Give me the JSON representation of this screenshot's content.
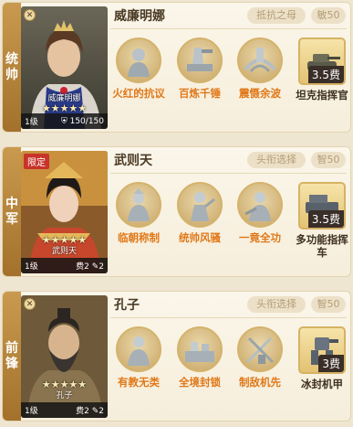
{
  "cards": [
    {
      "position_chars": [
        "统",
        "帅"
      ],
      "name": "威廉明娜",
      "portrait_name": "威廉明娜",
      "tag": "抵抗之母",
      "stat": "敏50",
      "stars": "★★★★★",
      "level": "1级",
      "troops": "150/150",
      "limited": false,
      "skills": [
        {
          "label": "火红的抗议",
          "icon": "protest-bust-icon",
          "orange": true
        },
        {
          "label": "百炼千锤",
          "icon": "forge-icon",
          "orange": true
        },
        {
          "label": "震慑余波",
          "icon": "shockwave-icon",
          "orange": true
        }
      ],
      "tactic": {
        "label": "坦克指挥官",
        "cost": "3.5费",
        "icon": "tank-icon"
      }
    },
    {
      "position_chars": [
        "中",
        "军"
      ],
      "name": "武则天",
      "portrait_name": "武则天",
      "tag": "头衔选择",
      "stat": "智50",
      "stars": "★★★★★",
      "level": "1级",
      "cost_text": "费2",
      "quill_text": "2",
      "limited": true,
      "limited_label": "限定",
      "skills": [
        {
          "label": "临朝称制",
          "icon": "empress-icon",
          "orange": true
        },
        {
          "label": "统帅风骚",
          "icon": "commander-icon",
          "orange": true
        },
        {
          "label": "一竟全功",
          "icon": "warrior-icon",
          "orange": true
        }
      ],
      "tactic": {
        "label": "多功能指挥车",
        "cost": "3.5费",
        "icon": "command-vehicle-icon"
      }
    },
    {
      "position_chars": [
        "前",
        "锋"
      ],
      "name": "孔子",
      "portrait_name": "孔子",
      "tag": "头衔选择",
      "stat": "智50",
      "stars": "★★★★★",
      "level": "1级",
      "cost_text": "费2",
      "quill_text": "2",
      "limited": false,
      "skills": [
        {
          "label": "有教无类",
          "icon": "sage-icon",
          "orange": true
        },
        {
          "label": "全境封锁",
          "icon": "lockdown-icon",
          "orange": true
        },
        {
          "label": "制敌机先",
          "icon": "swords-icon",
          "orange": true
        }
      ],
      "tactic": {
        "label": "冰封机甲",
        "cost": "3费",
        "icon": "ice-mech-icon"
      }
    }
  ]
}
